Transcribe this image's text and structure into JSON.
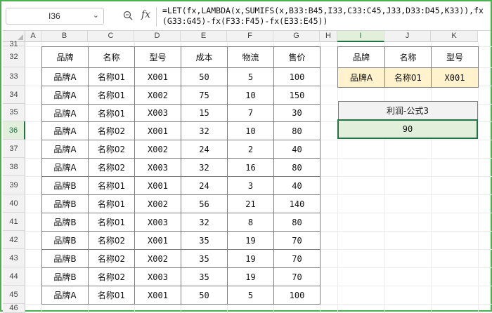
{
  "formula_bar": {
    "name_box": "I36",
    "fx_label": "fx",
    "formula": "=LET(fx,LAMBDA(x,SUMIFS(x,B33:B45,I33,C33:C45,J33,D33:D45,K33)),fx(G33:G45)-fx(F33:F45)-fx(E33:E45))"
  },
  "columns": [
    "A",
    "B",
    "C",
    "D",
    "E",
    "F",
    "G",
    "H",
    "I",
    "J",
    "K"
  ],
  "selected_column": "I",
  "rows": [
    "31",
    "32",
    "33",
    "34",
    "35",
    "36",
    "37",
    "38",
    "39",
    "40",
    "41",
    "42",
    "43",
    "44",
    "45",
    "46"
  ],
  "selected_row": "36",
  "main_table": {
    "headers": [
      "品牌",
      "名称",
      "型号",
      "成本",
      "物流",
      "售价"
    ],
    "rows": [
      [
        "品牌A",
        "名称01",
        "X001",
        "50",
        "5",
        "100"
      ],
      [
        "品牌A",
        "名称01",
        "X002",
        "75",
        "10",
        "150"
      ],
      [
        "品牌A",
        "名称01",
        "X003",
        "15",
        "7",
        "30"
      ],
      [
        "品牌A",
        "名称02",
        "X001",
        "32",
        "10",
        "80"
      ],
      [
        "品牌A",
        "名称02",
        "X002",
        "24",
        "2",
        "40"
      ],
      [
        "品牌A",
        "名称02",
        "X003",
        "32",
        "16",
        "80"
      ],
      [
        "品牌B",
        "名称01",
        "X001",
        "24",
        "3",
        "40"
      ],
      [
        "品牌B",
        "名称01",
        "X002",
        "56",
        "21",
        "140"
      ],
      [
        "品牌B",
        "名称01",
        "X003",
        "32",
        "8",
        "80"
      ],
      [
        "品牌B",
        "名称02",
        "X001",
        "35",
        "19",
        "70"
      ],
      [
        "品牌B",
        "名称02",
        "X002",
        "35",
        "19",
        "70"
      ],
      [
        "品牌B",
        "名称02",
        "X003",
        "35",
        "19",
        "70"
      ],
      [
        "品牌A",
        "名称01",
        "X001",
        "50",
        "5",
        "100"
      ]
    ]
  },
  "lookup_table": {
    "headers": [
      "品牌",
      "名称",
      "型号"
    ],
    "values": [
      "品牌A",
      "名称01",
      "X001"
    ]
  },
  "result_table": {
    "header": "利润-公式3",
    "value": "90"
  }
}
